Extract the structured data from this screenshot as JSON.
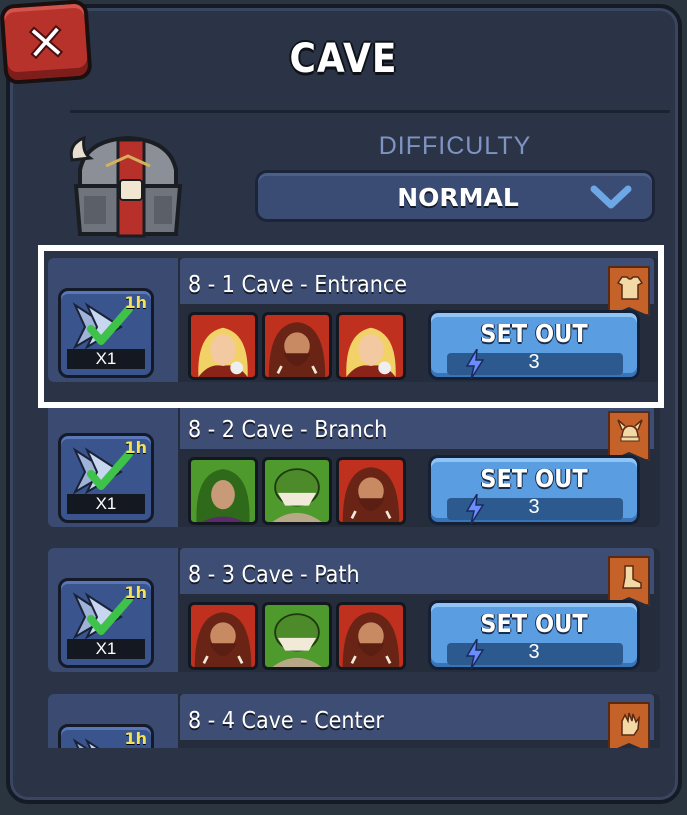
{
  "window": {
    "title": "CAVE",
    "close_icon": "close-x-icon"
  },
  "difficulty": {
    "label": "DIFFICULTY",
    "value": "NORMAL",
    "icon": "chevron-down-icon"
  },
  "stages": [
    {
      "name": "8 - 1 Cave - Entrance",
      "sweep_time": "1h",
      "sweep_count": "X1",
      "enemies": [
        "elf-warrior-portrait",
        "caveman-portrait",
        "elf-warrior-portrait"
      ],
      "button_label": "SET OUT",
      "energy_cost": "3",
      "reward_icon": "armor-icon"
    },
    {
      "name": "8 - 2 Cave - Branch",
      "sweep_time": "1h",
      "sweep_count": "X1",
      "enemies": [
        "dryad-portrait",
        "lizard-monster-portrait",
        "caveman-portrait"
      ],
      "button_label": "SET OUT",
      "energy_cost": "3",
      "reward_icon": "helmet-icon"
    },
    {
      "name": "8 - 3 Cave - Path",
      "sweep_time": "1h",
      "sweep_count": "X1",
      "enemies": [
        "caveman-portrait",
        "lizard-monster-portrait",
        "caveman-portrait"
      ],
      "button_label": "SET OUT",
      "energy_cost": "3",
      "reward_icon": "boots-icon"
    },
    {
      "name": "8 - 4 Cave - Center",
      "sweep_time": "1h",
      "reward_icon": "gloves-icon"
    }
  ],
  "colors": {
    "panel": "#2b3447",
    "accent_button": "#5a9de0",
    "close_button": "#b8322c",
    "highlight": "#ffffff"
  }
}
